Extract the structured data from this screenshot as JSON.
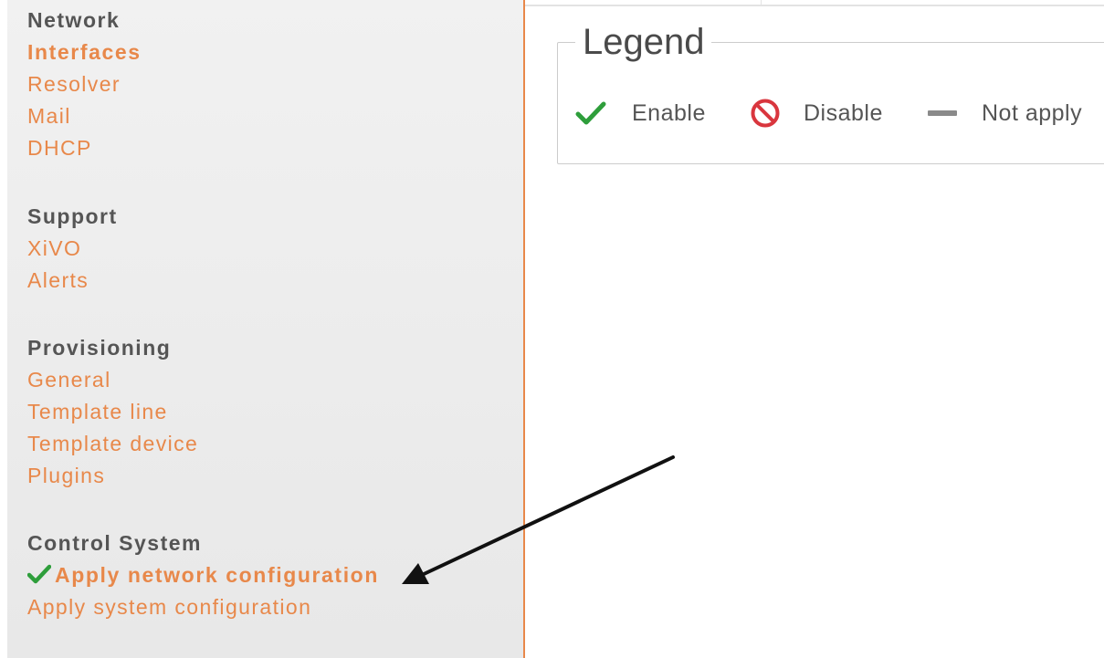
{
  "sidebar": {
    "sections": [
      {
        "title": "Network",
        "items": [
          {
            "label": "Interfaces",
            "active": true
          },
          {
            "label": "Resolver"
          },
          {
            "label": "Mail"
          },
          {
            "label": "DHCP"
          }
        ]
      },
      {
        "title": "Support",
        "items": [
          {
            "label": "XiVO"
          },
          {
            "label": "Alerts"
          }
        ]
      },
      {
        "title": "Provisioning",
        "items": [
          {
            "label": "General"
          },
          {
            "label": "Template line"
          },
          {
            "label": "Template device"
          },
          {
            "label": "Plugins"
          }
        ]
      },
      {
        "title": "Control System",
        "items": [
          {
            "label": "Apply network configuration",
            "active": true,
            "icon": "check-icon"
          },
          {
            "label": "Apply system configuration"
          }
        ]
      }
    ]
  },
  "legend": {
    "title": "Legend",
    "items": [
      {
        "icon": "check-icon",
        "label": "Enable"
      },
      {
        "icon": "prohibited-icon",
        "label": "Disable"
      },
      {
        "icon": "dash-icon",
        "label": "Not apply"
      }
    ]
  },
  "colors": {
    "accent": "#e8884a",
    "heading": "#555555",
    "enable": "#2e9e3b",
    "disable": "#d9363e",
    "not_apply": "#8a8a8a",
    "annotation_arrow": "#111111"
  }
}
